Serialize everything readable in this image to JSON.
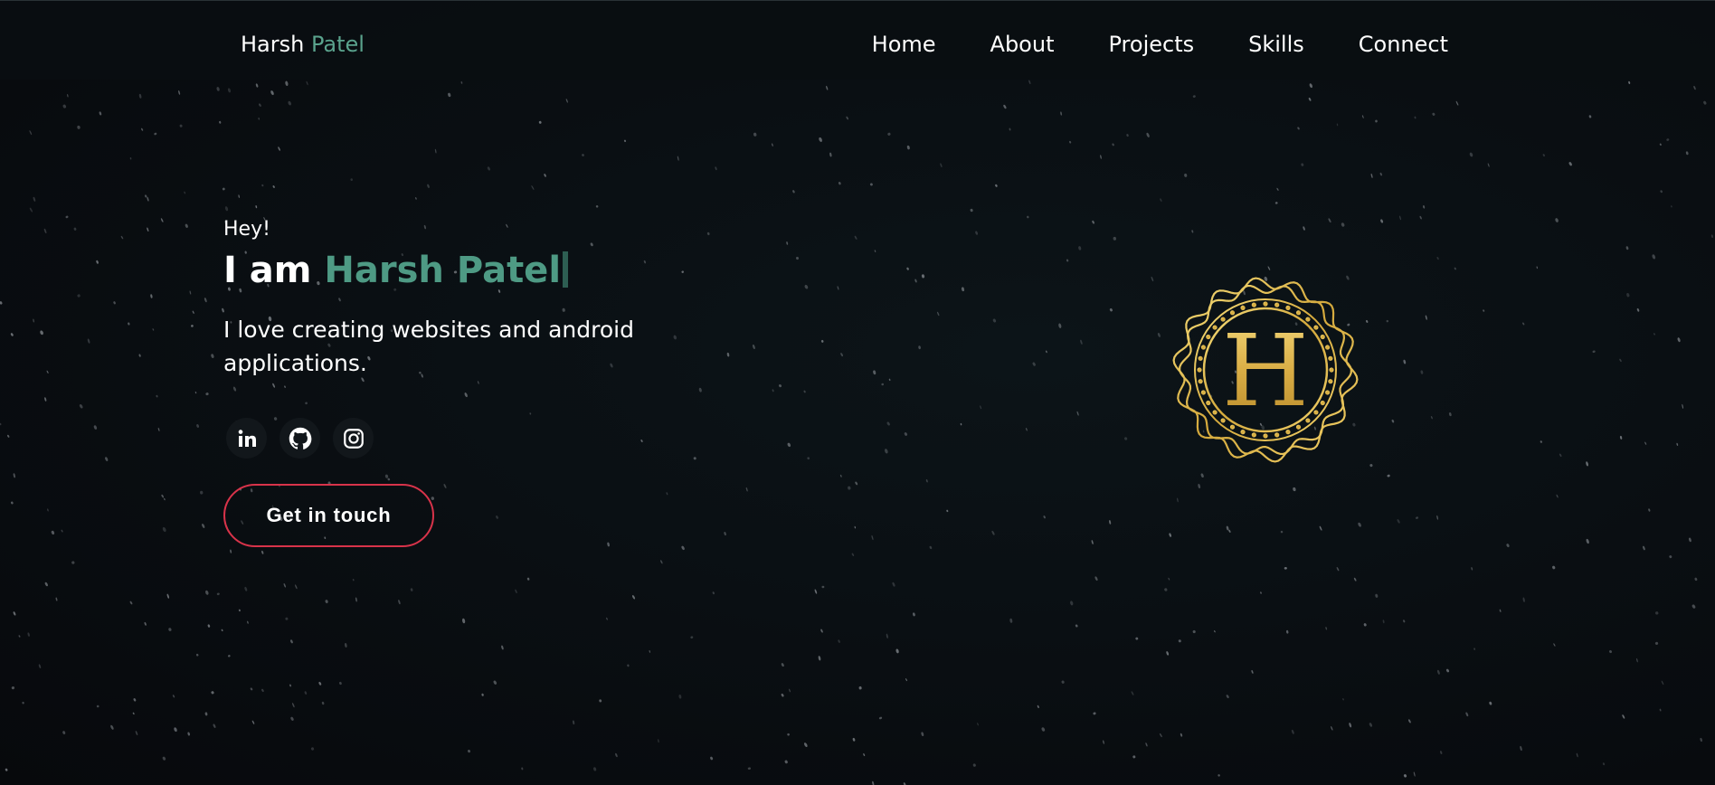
{
  "nav": {
    "brand_first": "Harsh",
    "brand_last": "Patel",
    "links": [
      "Home",
      "About",
      "Projects",
      "Skills",
      "Connect"
    ]
  },
  "hero": {
    "greeting": "Hey!",
    "headline_prefix": "I am",
    "headline_name": "Harsh Patel",
    "tagline": "I love creating websites and android applications.",
    "socials": [
      {
        "icon": "linkedin-icon"
      },
      {
        "icon": "github-icon"
      },
      {
        "icon": "instagram-icon"
      }
    ],
    "cta_label": "Get in touch",
    "logo_letter": "H"
  },
  "colors": {
    "accent": "#5aa38d",
    "cta_border": "#d8334a",
    "logo_gold": "#d4a93c"
  }
}
